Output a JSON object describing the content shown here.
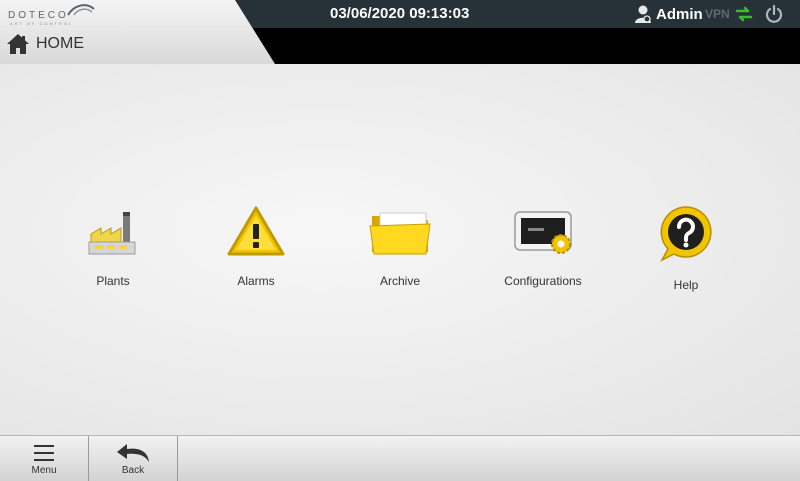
{
  "header": {
    "brand": "DOTECO",
    "brand_tagline": "ART OF CONTROL",
    "datetime": "03/06/2020 09:13:03",
    "user": "Admin",
    "vpn_label": "VPN"
  },
  "breadcrumb": {
    "label": "HOME"
  },
  "tiles": [
    {
      "label": "Plants",
      "icon": "factory-icon"
    },
    {
      "label": "Alarms",
      "icon": "warning-icon"
    },
    {
      "label": "Archive",
      "icon": "folder-icon"
    },
    {
      "label": "Configurations",
      "icon": "config-device-icon"
    },
    {
      "label": "Help",
      "icon": "help-icon"
    }
  ],
  "footer": {
    "menu_label": "Menu",
    "back_label": "Back"
  },
  "colors": {
    "topbar": "#263238",
    "accent_yellow": "#f2c400",
    "vpn_transfer_green": "#3dbb2f"
  }
}
